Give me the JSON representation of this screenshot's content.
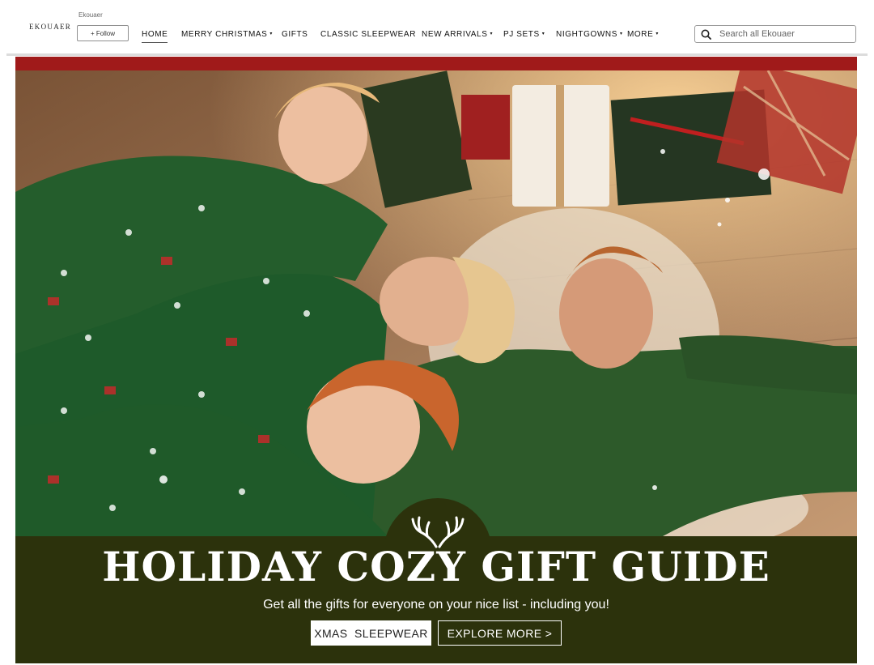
{
  "store": {
    "logo_text": "EKOUAER",
    "brand_name": "Ekouaer",
    "follow_label": "+ Follow"
  },
  "nav": {
    "items": [
      {
        "label": "HOME",
        "active": true,
        "dropdown": false
      },
      {
        "label": "MERRY CHRISTMAS",
        "active": false,
        "dropdown": true
      },
      {
        "label": "GIFTS",
        "active": false,
        "dropdown": false
      },
      {
        "label": "CLASSIC SLEEPWEAR",
        "active": false,
        "dropdown": false
      },
      {
        "label": "NEW ARRIVALS",
        "active": false,
        "dropdown": true
      },
      {
        "label": "PJ SETS",
        "active": false,
        "dropdown": true
      },
      {
        "label": "NIGHTGOWNS",
        "active": false,
        "dropdown": true
      },
      {
        "label": "MORE",
        "active": false,
        "dropdown": true
      }
    ],
    "caret_glyph": "▾"
  },
  "search": {
    "placeholder": "Search all Ekouaer",
    "icon": "search-icon"
  },
  "hero": {
    "headline": "HOLIDAY COZY GIFT GUIDE",
    "subline": "Get all the gifts for everyone on your nice list - including you!",
    "primary_cta": "XMAS  SLEEPWEAR",
    "secondary_cta": "EXPLORE MORE >",
    "antler_icon": "antlers-icon",
    "colors": {
      "banner_strip": "#a01a1a",
      "banner_bottom": "#2c320c",
      "pajama_green": "#2f5a24"
    }
  }
}
